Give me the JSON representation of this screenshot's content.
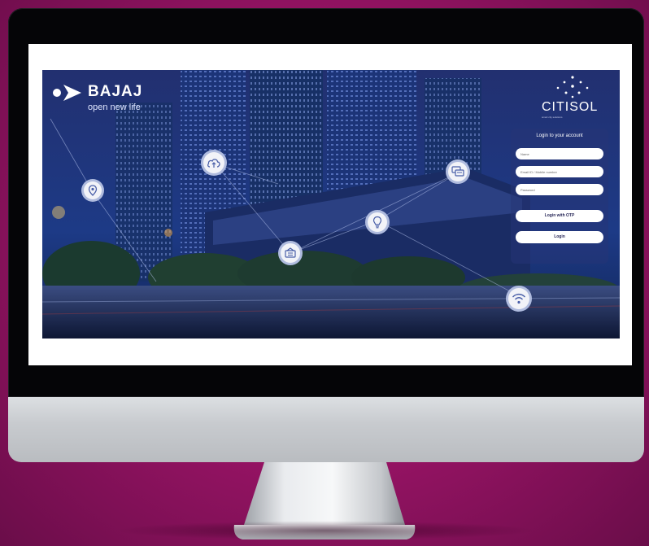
{
  "brand": {
    "name": "BAJAJ",
    "tagline": "open new life"
  },
  "partner": {
    "name": "CITISOL",
    "subtitle": "smart city solutions"
  },
  "login": {
    "title": "Login to your account",
    "name_placeholder": "Name",
    "email_placeholder": "Email ID / Mobile number",
    "password_placeholder": "Password",
    "otp_button": "Login with OTP",
    "login_button": "Login"
  },
  "icons": [
    "location-pin-icon",
    "cloud-upload-icon",
    "chat-icon",
    "lightbulb-icon",
    "network-hub-icon",
    "wifi-icon"
  ],
  "colors": {
    "background": "#9b1467",
    "bezel": "#050507",
    "screen_night": "#1b2e72",
    "panel": "#263476"
  }
}
